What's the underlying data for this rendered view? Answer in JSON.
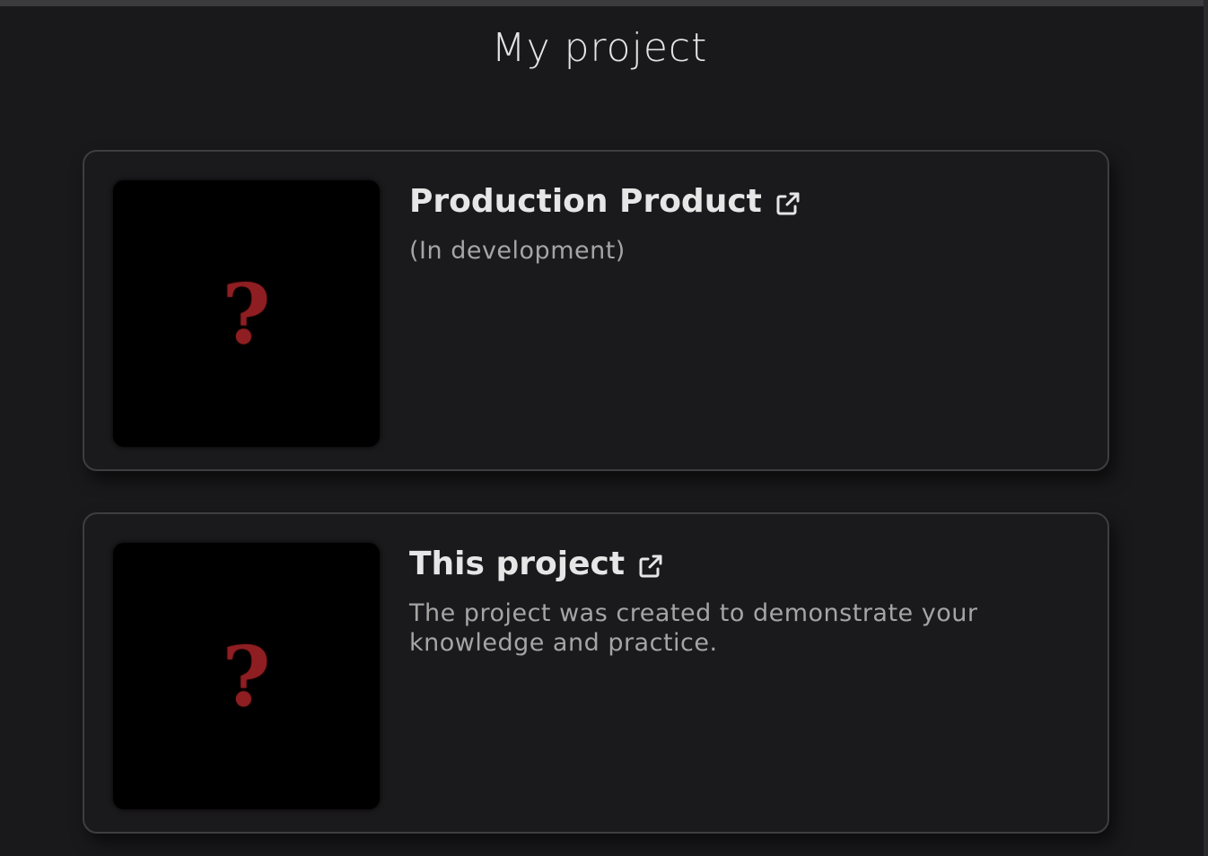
{
  "page": {
    "title": "My project"
  },
  "projects": [
    {
      "title": "Production Product",
      "description": "(In development)",
      "thumbnail_symbol": "?",
      "link_icon": "external-link-icon"
    },
    {
      "title": "This project",
      "description": "The project was created to demonstrate your knowledge and practice.",
      "thumbnail_symbol": "?",
      "link_icon": "external-link-icon"
    }
  ],
  "colors": {
    "background": "#19181a",
    "card_border": "#3e3d3f",
    "title_text": "#e6e6e6",
    "desc_text": "#a5a5a5",
    "placeholder_mark": "#8e1e22"
  }
}
